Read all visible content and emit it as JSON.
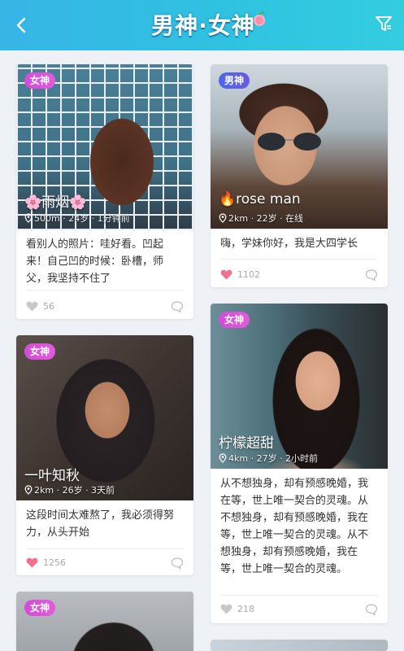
{
  "header": {
    "title": "男神·女神"
  },
  "cards": [
    {
      "tag": "女神",
      "name": "🌸雨烟🌸",
      "meta": "500m · 24岁 · 1分钟前",
      "desc": "看别人的照片：哇好看。凹起来！自己凹的时候：卧槽，师父，我坚持不住了",
      "likes": "56"
    },
    {
      "tag": "男神",
      "name": "🔥rose man",
      "meta": "2km · 22岁 · 在线",
      "desc": "嗨，学妹你好，我是大四学长",
      "likes": "1102"
    },
    {
      "tag": "女神",
      "name": "一叶知秋",
      "meta": "2km · 26岁 · 3天前",
      "desc": "这段时间太难熬了，我必须得努力，从头开始",
      "likes": "1256"
    },
    {
      "tag": "女神",
      "name": "柠檬超甜",
      "meta": "4km · 27岁 · 2小时前",
      "desc": "从不想独身，却有预感晚婚，我在等，世上唯一契合的灵魂。从不想独身，却有预感晚婚，我在等，世上唯一契合的灵魂。从不想独身，却有预感晚婚，我在等，世上唯一契合的灵魂。",
      "likes": "218"
    },
    {
      "tag": "女神"
    }
  ],
  "colors": {
    "header": "#37b5e6",
    "female_tag": "#d14dd6",
    "male_tag": "#4a66e8",
    "liked_heart": "#f2708f",
    "unliked_heart": "#c8c8c8"
  }
}
